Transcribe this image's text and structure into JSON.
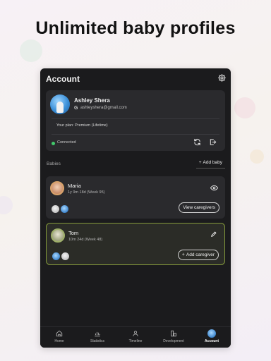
{
  "headline": "Unlimited baby profiles",
  "header": {
    "title": "Account"
  },
  "profile": {
    "name": "Ashley Shera",
    "email": "ashleyshera@gmail.com",
    "google_glyph": "G",
    "plan": "Your plan: Premium (Lifetime)",
    "status": "Connected",
    "status_color": "#42c96b"
  },
  "babies": {
    "label": "Babies",
    "add_label": "Add baby",
    "items": [
      {
        "name": "Maria",
        "age": "1y 9m 18d (Week 95)",
        "action": "View caregivers",
        "action_icon": "eye-icon"
      },
      {
        "name": "Tom",
        "age": "10m 24d (Week 48)",
        "action": "Add caregiver",
        "action_icon": "pencil-icon",
        "selected": true,
        "accent": "#84993b"
      }
    ]
  },
  "nav": [
    {
      "label": "Home",
      "icon": "home-icon"
    },
    {
      "label": "Statistics",
      "icon": "statistics-icon"
    },
    {
      "label": "Timeline",
      "icon": "timeline-icon"
    },
    {
      "label": "Development",
      "icon": "development-icon"
    },
    {
      "label": "Account",
      "icon": "avatar",
      "active": true
    }
  ]
}
